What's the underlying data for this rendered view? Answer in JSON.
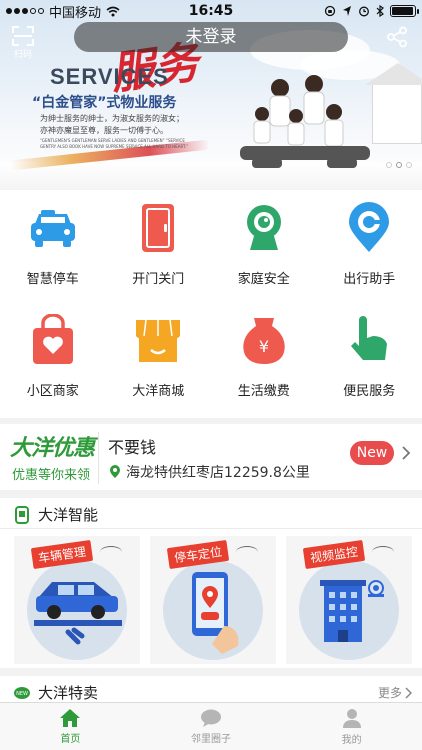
{
  "status_bar": {
    "carrier": "中国移动",
    "time": "16:45",
    "battery_level": 0.95
  },
  "header": {
    "title": "未登录",
    "scan_label": "扫码"
  },
  "banner": {
    "calligraphy": "服务",
    "services": "SERVICES",
    "slogan": "“白金管家”式物业服务",
    "sub_line1": "为绅士服务的绅士，为淑女服务的淑女；",
    "sub_line2": "亦神亦魔显至尊，服务一切傅于心。",
    "english": "“GENTLEMEN'S GENTLEMAN SERVE LADIES AND GENTLEMEN” “SERVICE GENTRY ALSO BOOK HAVE NOW SUPREME SERVICE ALL HARD TO HEART.”"
  },
  "features": [
    {
      "label": "智慧停车",
      "icon": "car-icon",
      "color": "#2e9be6"
    },
    {
      "label": "开门关门",
      "icon": "door-icon",
      "color": "#ee5a4e"
    },
    {
      "label": "家庭安全",
      "icon": "camera-icon",
      "color": "#2fa66a"
    },
    {
      "label": "出行助手",
      "icon": "location-icon",
      "color": "#2e9be6"
    },
    {
      "label": "小区商家",
      "icon": "shopping-bag-icon",
      "color": "#ee5a4e"
    },
    {
      "label": "大洋商城",
      "icon": "store-icon",
      "color": "#f5a623"
    },
    {
      "label": "生活缴费",
      "icon": "money-bag-icon",
      "color": "#ee5a4e"
    },
    {
      "label": "便民服务",
      "icon": "hand-icon",
      "color": "#2fa66a"
    }
  ],
  "promo": {
    "logo": "大洋优惠",
    "slogan": "优惠等你来领",
    "title": "不要钱",
    "store": "海龙特供红枣店12259.8公里",
    "badge": "New"
  },
  "smart": {
    "title": "大洋智能",
    "cards": [
      {
        "tag": "车辆管理"
      },
      {
        "tag": "停车定位"
      },
      {
        "tag": "视频监控"
      }
    ]
  },
  "special": {
    "title": "大洋特卖",
    "more": "更多"
  },
  "tabbar": [
    {
      "label": "首页",
      "active": true
    },
    {
      "label": "邻里圈子",
      "active": false
    },
    {
      "label": "我的",
      "active": false
    }
  ],
  "colors": {
    "accent_green": "#2f9a3a",
    "accent_red": "#e84c4c",
    "accent_blue": "#2e9be6"
  }
}
